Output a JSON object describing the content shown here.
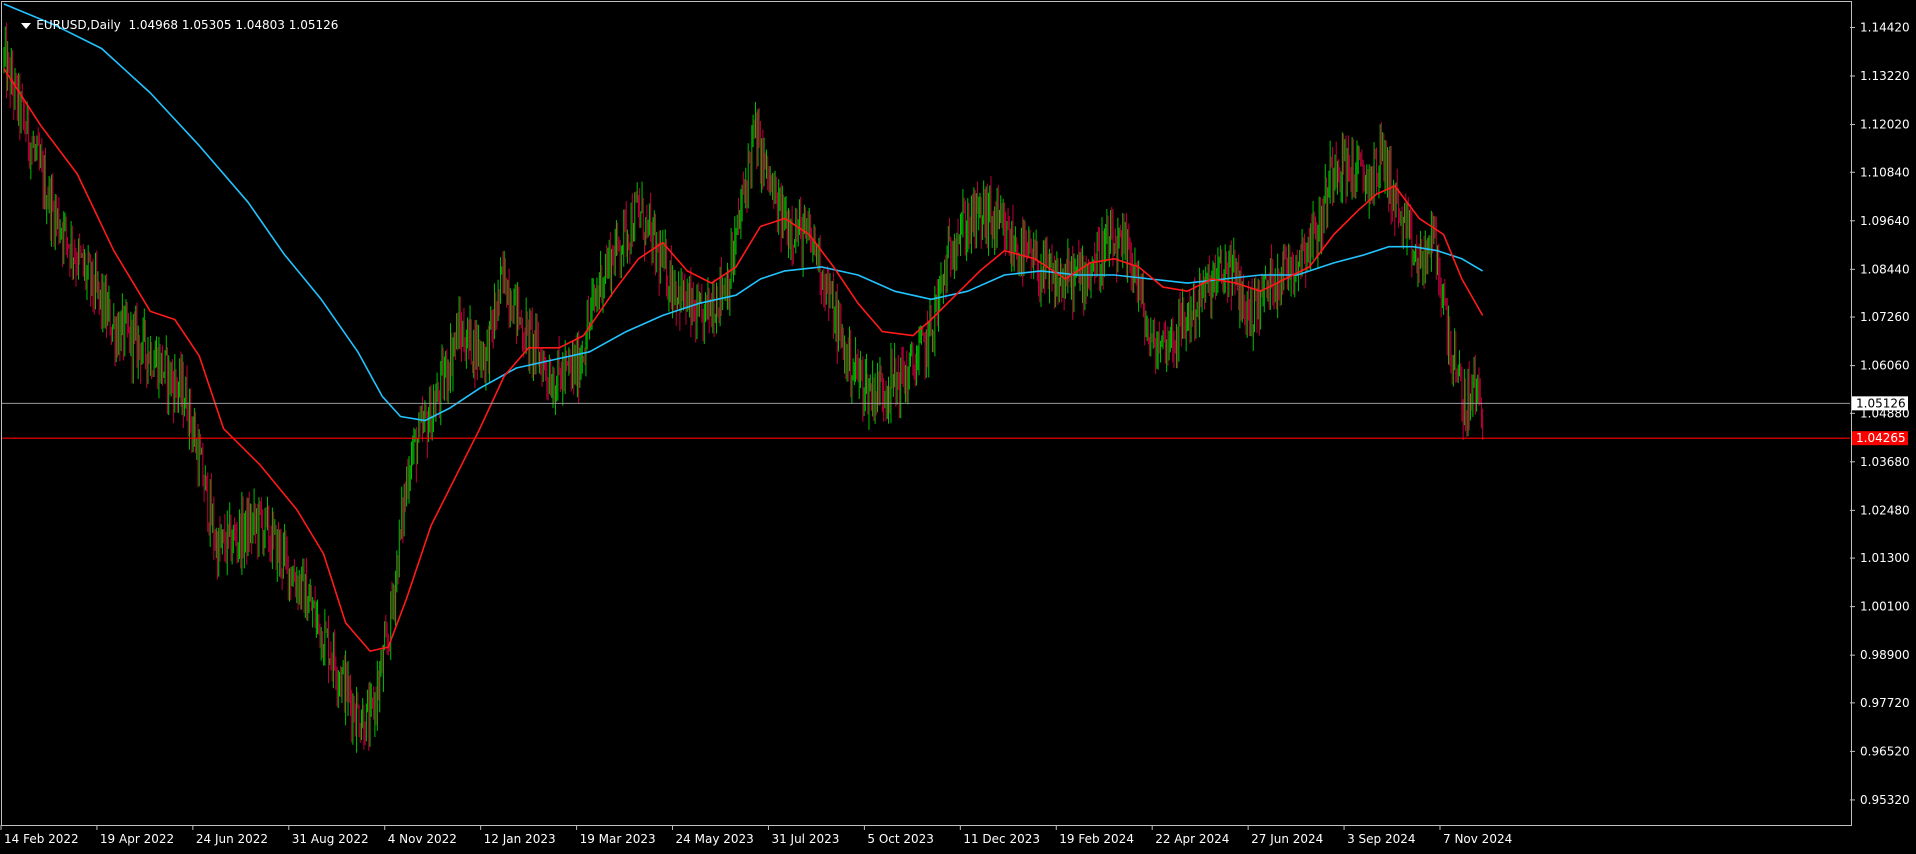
{
  "header": {
    "symbol": "EURUSD,Daily",
    "ohlc": "1.04968 1.05305 1.04803 1.05126"
  },
  "colors": {
    "background": "#000000",
    "bull_candle": "#00c000",
    "bear_candle": "#c0003a",
    "ma_fast": "#ff1a1a",
    "ma_slow": "#22c4ff",
    "bid_line": "#9a9a9a",
    "level_line": "#ff0000",
    "axis_text": "#ffffff",
    "frame": "#c0c0c0"
  },
  "chart_data": {
    "type": "candlestick",
    "symbol": "EURUSD",
    "timeframe": "Daily",
    "ylim": [
      0.947,
      1.1505
    ],
    "y_ticks": [
      "1.14420",
      "1.13220",
      "1.12020",
      "1.10840",
      "1.09640",
      "1.08440",
      "1.07260",
      "1.06060",
      "1.04880",
      "1.03680",
      "1.02480",
      "1.01300",
      "1.00100",
      "0.98900",
      "0.97720",
      "0.96520",
      "0.95320"
    ],
    "x_ticks": [
      "14 Feb 2022",
      "19 Apr 2022",
      "24 Jun 2022",
      "31 Aug 2022",
      "4 Nov 2022",
      "12 Jan 2023",
      "19 Mar 2023",
      "24 May 2023",
      "31 Jul 2023",
      "5 Oct 2023",
      "11 Dec 2023",
      "19 Feb 2024",
      "22 Apr 2024",
      "27 Jun 2024",
      "3 Sep 2024",
      "7 Nov 2024"
    ],
    "price_path": [
      [
        0,
        1.136
      ],
      [
        40,
        1.099
      ],
      [
        90,
        1.07
      ],
      [
        120,
        1.064
      ],
      [
        150,
        1.052
      ],
      [
        175,
        1.015
      ],
      [
        210,
        1.022
      ],
      [
        245,
        1.005
      ],
      [
        268,
        0.99
      ],
      [
        288,
        0.975
      ],
      [
        300,
        0.972
      ],
      [
        315,
        0.993
      ],
      [
        332,
        1.037
      ],
      [
        355,
        1.052
      ],
      [
        372,
        1.069
      ],
      [
        395,
        1.063
      ],
      [
        410,
        1.083
      ],
      [
        425,
        1.07
      ],
      [
        450,
        1.057
      ],
      [
        470,
        1.06
      ],
      [
        490,
        1.083
      ],
      [
        520,
        1.099
      ],
      [
        540,
        1.085
      ],
      [
        570,
        1.071
      ],
      [
        595,
        1.083
      ],
      [
        615,
        1.118
      ],
      [
        635,
        1.098
      ],
      [
        665,
        1.09
      ],
      [
        690,
        1.063
      ],
      [
        710,
        1.054
      ],
      [
        740,
        1.058
      ],
      [
        758,
        1.067
      ],
      [
        780,
        1.094
      ],
      [
        805,
        1.098
      ],
      [
        825,
        1.091
      ],
      [
        860,
        1.081
      ],
      [
        885,
        1.083
      ],
      [
        905,
        1.09
      ],
      [
        925,
        1.087
      ],
      [
        940,
        1.065
      ],
      [
        960,
        1.068
      ],
      [
        985,
        1.079
      ],
      [
        1005,
        1.085
      ],
      [
        1020,
        1.073
      ],
      [
        1040,
        1.082
      ],
      [
        1060,
        1.087
      ],
      [
        1080,
        1.096
      ],
      [
        1090,
        1.112
      ],
      [
        1105,
        1.109
      ],
      [
        1120,
        1.106
      ],
      [
        1130,
        1.113
      ],
      [
        1145,
        1.096
      ],
      [
        1160,
        1.085
      ],
      [
        1172,
        1.092
      ],
      [
        1180,
        1.076
      ],
      [
        1190,
        1.058
      ],
      [
        1198,
        1.05
      ],
      [
        1205,
        1.055
      ],
      [
        1212,
        1.051
      ]
    ],
    "ma_fast": {
      "period_label": "",
      "points": [
        [
          0,
          1.134
        ],
        [
          30,
          1.12
        ],
        [
          60,
          1.108
        ],
        [
          90,
          1.089
        ],
        [
          120,
          1.074
        ],
        [
          140,
          1.072
        ],
        [
          160,
          1.063
        ],
        [
          180,
          1.045
        ],
        [
          210,
          1.036
        ],
        [
          240,
          1.025
        ],
        [
          262,
          1.014
        ],
        [
          280,
          0.997
        ],
        [
          300,
          0.99
        ],
        [
          315,
          0.991
        ],
        [
          330,
          1.003
        ],
        [
          350,
          1.021
        ],
        [
          370,
          1.033
        ],
        [
          390,
          1.045
        ],
        [
          410,
          1.058
        ],
        [
          430,
          1.065
        ],
        [
          455,
          1.065
        ],
        [
          475,
          1.068
        ],
        [
          500,
          1.079
        ],
        [
          520,
          1.087
        ],
        [
          540,
          1.091
        ],
        [
          560,
          1.084
        ],
        [
          580,
          1.081
        ],
        [
          600,
          1.085
        ],
        [
          620,
          1.095
        ],
        [
          640,
          1.097
        ],
        [
          660,
          1.093
        ],
        [
          680,
          1.085
        ],
        [
          700,
          1.076
        ],
        [
          720,
          1.069
        ],
        [
          745,
          1.068
        ],
        [
          760,
          1.072
        ],
        [
          780,
          1.078
        ],
        [
          800,
          1.084
        ],
        [
          820,
          1.089
        ],
        [
          845,
          1.087
        ],
        [
          870,
          1.082
        ],
        [
          890,
          1.086
        ],
        [
          910,
          1.087
        ],
        [
          930,
          1.085
        ],
        [
          950,
          1.08
        ],
        [
          970,
          1.079
        ],
        [
          990,
          1.082
        ],
        [
          1010,
          1.081
        ],
        [
          1030,
          1.079
        ],
        [
          1050,
          1.082
        ],
        [
          1070,
          1.085
        ],
        [
          1090,
          1.093
        ],
        [
          1110,
          1.099
        ],
        [
          1125,
          1.103
        ],
        [
          1140,
          1.105
        ],
        [
          1160,
          1.097
        ],
        [
          1180,
          1.093
        ],
        [
          1195,
          1.082
        ],
        [
          1212,
          1.073
        ]
      ]
    },
    "ma_slow": {
      "period_label": "",
      "points": [
        [
          0,
          1.15
        ],
        [
          40,
          1.145
        ],
        [
          80,
          1.139
        ],
        [
          120,
          1.128
        ],
        [
          160,
          1.115
        ],
        [
          200,
          1.101
        ],
        [
          230,
          1.088
        ],
        [
          260,
          1.077
        ],
        [
          290,
          1.064
        ],
        [
          310,
          1.053
        ],
        [
          325,
          1.048
        ],
        [
          345,
          1.047
        ],
        [
          365,
          1.05
        ],
        [
          390,
          1.055
        ],
        [
          420,
          1.06
        ],
        [
          450,
          1.062
        ],
        [
          480,
          1.064
        ],
        [
          510,
          1.069
        ],
        [
          540,
          1.073
        ],
        [
          570,
          1.076
        ],
        [
          600,
          1.078
        ],
        [
          620,
          1.082
        ],
        [
          640,
          1.084
        ],
        [
          670,
          1.085
        ],
        [
          700,
          1.083
        ],
        [
          730,
          1.079
        ],
        [
          760,
          1.077
        ],
        [
          790,
          1.079
        ],
        [
          820,
          1.083
        ],
        [
          850,
          1.084
        ],
        [
          880,
          1.083
        ],
        [
          910,
          1.083
        ],
        [
          940,
          1.082
        ],
        [
          970,
          1.081
        ],
        [
          1000,
          1.082
        ],
        [
          1030,
          1.083
        ],
        [
          1060,
          1.083
        ],
        [
          1090,
          1.086
        ],
        [
          1115,
          1.088
        ],
        [
          1135,
          1.09
        ],
        [
          1155,
          1.09
        ],
        [
          1175,
          1.089
        ],
        [
          1195,
          1.087
        ],
        [
          1212,
          1.084
        ]
      ]
    },
    "bid_price_label": "1.05126",
    "bid_price": 1.05126,
    "level_label": "1.04265",
    "level_price": 1.04265,
    "grid": false,
    "legend": "none"
  }
}
